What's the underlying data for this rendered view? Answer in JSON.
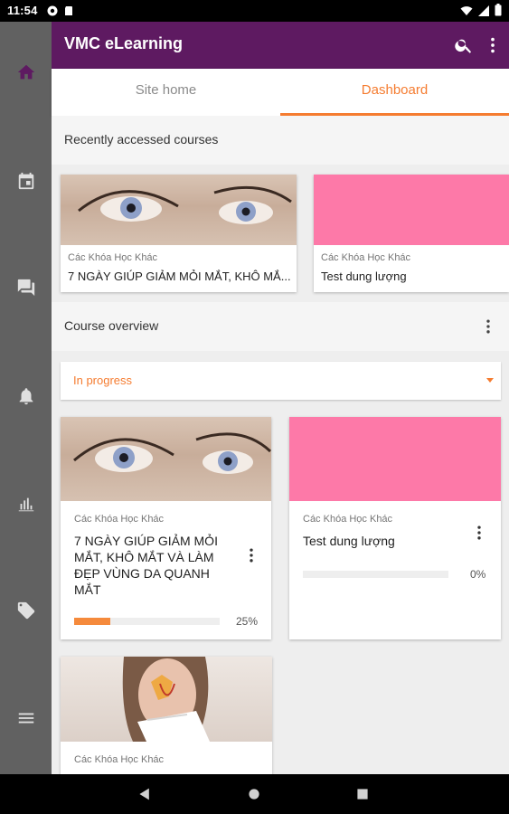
{
  "status_bar": {
    "time": "11:54",
    "left_icons": [
      "notification-icon",
      "sd-card-icon"
    ],
    "right_icons": [
      "wifi-icon",
      "signal-icon",
      "battery-icon"
    ]
  },
  "rail": {
    "items": [
      {
        "icon": "home-icon",
        "active": true
      },
      {
        "icon": "calendar-icon",
        "active": false
      },
      {
        "icon": "messages-icon",
        "active": false
      },
      {
        "icon": "notifications-icon",
        "active": false
      },
      {
        "icon": "grades-icon",
        "active": false
      },
      {
        "icon": "tag-icon",
        "active": false
      },
      {
        "icon": "menu-icon",
        "active": false
      }
    ]
  },
  "appbar": {
    "title": "VMC eLearning",
    "actions": [
      "search-icon",
      "more-vert-icon"
    ]
  },
  "tabs": [
    {
      "label": "Site home",
      "active": false
    },
    {
      "label": "Dashboard",
      "active": true
    }
  ],
  "recent": {
    "title": "Recently accessed courses",
    "courses": [
      {
        "category": "Các Khóa Học Khác",
        "title": "7 NGÀY GIÚP GIẢM MỎI MẮT, KHÔ MẮ...",
        "image": "eyes-photo"
      },
      {
        "category": "Các Khóa Học Khác",
        "title": "Test dung lượng",
        "image": "pink-placeholder"
      }
    ]
  },
  "overview": {
    "title": "Course overview",
    "filter_value": "In progress",
    "courses": [
      {
        "category": "Các Khóa Học Khác",
        "title_lines": [
          "7 NGÀY GIÚP GIẢM MỎI",
          "MẮT, KHÔ MẮT VÀ LÀM",
          "ĐẸP VÙNG DA QUANH",
          "MẮT"
        ],
        "progress": 25,
        "progress_label": "25%",
        "image": "eyes-photo"
      },
      {
        "category": "Các Khóa Học Khác",
        "title_lines": [
          "Test dung lượng"
        ],
        "progress": 0,
        "progress_label": "0%",
        "image": "pink-placeholder"
      },
      {
        "category": "Các Khóa Học Khác",
        "title_lines": [],
        "image": "sinus-photo"
      }
    ]
  },
  "colors": {
    "primary": "#5e1a61",
    "accent": "#f57c30",
    "rail": "#616161",
    "pink": "#fd79a8"
  },
  "navbar": {
    "buttons": [
      "back-icon",
      "home-circle-icon",
      "recents-icon"
    ]
  }
}
